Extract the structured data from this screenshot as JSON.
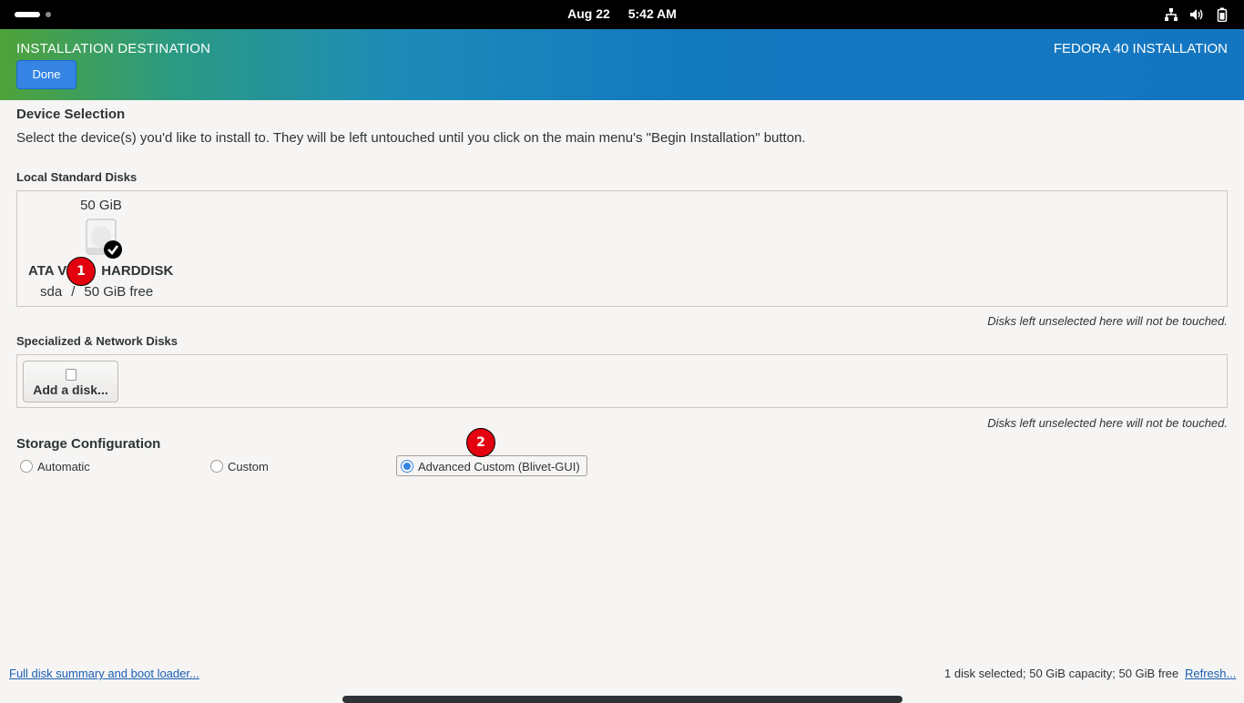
{
  "topbar": {
    "date": "Aug 22",
    "time": "5:42 AM",
    "icons": [
      "network-icon",
      "volume-icon",
      "battery-icon"
    ]
  },
  "header": {
    "title": "INSTALLATION DESTINATION",
    "product": "FEDORA 40 INSTALLATION",
    "done_label": "Done"
  },
  "device_selection": {
    "heading": "Device Selection",
    "description": "Select the device(s) you'd like to install to.  They will be left untouched until you click on the main menu's \"Begin Installation\" button."
  },
  "local_disks": {
    "heading": "Local Standard Disks",
    "disks": [
      {
        "size": "50 GiB",
        "name_prefix": "ATA V",
        "name_suffix": "HARDDISK",
        "device": "sda",
        "separator": "/",
        "free": "50 GiB free",
        "selected": true
      }
    ],
    "hint": "Disks left unselected here will not be touched."
  },
  "network_disks": {
    "heading": "Specialized & Network Disks",
    "add_label": "Add a disk...",
    "hint": "Disks left unselected here will not be touched."
  },
  "storage_config": {
    "heading": "Storage Configuration",
    "options": [
      {
        "label": "Automatic",
        "selected": false
      },
      {
        "label": "Custom",
        "selected": false
      },
      {
        "label": "Advanced Custom (Blivet-GUI)",
        "selected": true
      }
    ]
  },
  "markers": [
    "1",
    "2"
  ],
  "footer": {
    "summary_link": "Full disk summary and boot loader...",
    "status": "1 disk selected; 50 GiB capacity; 50 GiB free",
    "refresh_link": "Refresh..."
  },
  "colors": {
    "accent": "#3584e4",
    "link": "#1a5fb4",
    "marker": "#e3000f"
  }
}
